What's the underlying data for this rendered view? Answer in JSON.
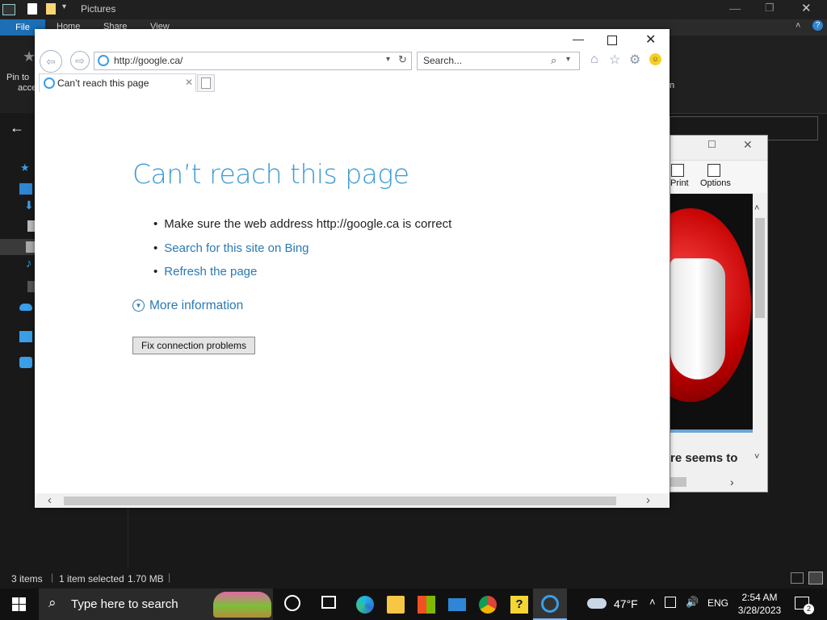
{
  "explorer": {
    "title": "Pictures",
    "ribbon_tabs": [
      "File",
      "Home",
      "Share",
      "View"
    ],
    "toolbar_pin_label_part1": "Pin to",
    "toolbar_pin_label_part2": "acce",
    "toolbar_right_fragment": "n",
    "status_items": "3 items",
    "status_selected": "1 item selected",
    "status_size": "1.70 MB"
  },
  "viewer": {
    "print_label": "Print",
    "options_label": "Options",
    "caption_line1": "re seems to"
  },
  "ie": {
    "address_value": "http://google.ca/",
    "search_placeholder": "Search...",
    "tab_title": "Can’t reach this page",
    "heading": "Can’t reach this page",
    "bullet1": "Make sure the web address http://google.ca is correct",
    "bullet2": "Search for this site on Bing",
    "bullet3": "Refresh the page",
    "more_info": "More information",
    "fix_button": "Fix connection problems"
  },
  "taskbar": {
    "search_placeholder": "Type here to search",
    "weather_temp": "47°F",
    "language": "ENG",
    "time": "2:54 AM",
    "date": "3/28/2023",
    "notification_count": "2"
  },
  "colors": {
    "ie_heading": "#3b9bd1",
    "link": "#2a7ab3",
    "file_tab": "#1c6fb4"
  }
}
